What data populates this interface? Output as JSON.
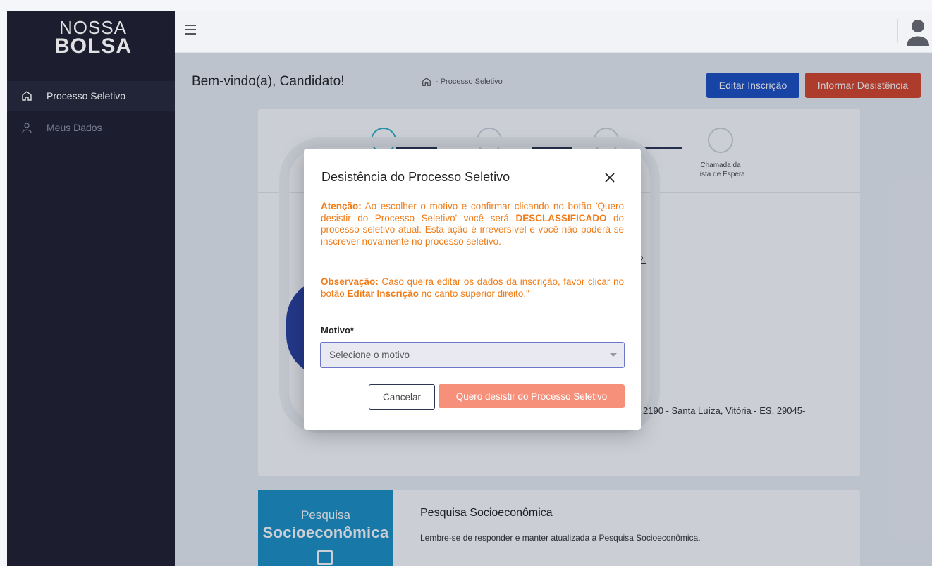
{
  "brand": {
    "line1": "NOSSA",
    "line2": "BOLSA"
  },
  "sidebar": {
    "items": [
      {
        "label": "Processo Seletivo",
        "icon": "home-icon",
        "active": true
      },
      {
        "label": "Meus Dados",
        "icon": "user-icon",
        "active": false
      }
    ]
  },
  "header": {
    "welcome": "Bem-vindo(a), Candidato!",
    "breadcrumb": "· Processo Seletivo",
    "edit_label": "Editar Inscrição",
    "quit_label": "Informar Desistência"
  },
  "steps": {
    "label_line1": "Chamada da",
    "label_line2": "Lista de Espera"
  },
  "address_partial": "2190 - Santa Luíza, Vitória - ES, 29045-",
  "small_link": "2.",
  "pesquisa": {
    "image_line1": "Pesquisa",
    "image_line2": "Socioeconômica",
    "title": "Pesquisa Socioeconômica",
    "text": "Lembre-se de responder e manter atualizada a Pesquisa Socioeconômica."
  },
  "modal": {
    "title": "Desistência do Processo Seletivo",
    "warning_label": "Atenção:",
    "warning_text_1": " Ao escolher o motivo e confirmar clicando no botão 'Quero desistir do Processo Seletivo' você será ",
    "warning_emphasis": "DESCLASSIFICADO",
    "warning_text_2": " do processo seletivo atual. Esta ação é irreversível e você não poderá se inscrever novamente no processo seletivo.",
    "obs_label": "Observação:",
    "obs_text_1": " Caso queira editar os dados da inscrição, favor clicar no botão ",
    "obs_emphasis": "Editar Inscrição",
    "obs_text_2": " no canto superior direito.\"",
    "motivo_label": "Motivo*",
    "select_placeholder": "Selecione o motivo",
    "cancel_label": "Cancelar",
    "confirm_label": "Quero desistir do Processo Seletivo"
  },
  "colors": {
    "sidebar_bg": "#1f2233",
    "primary_blue": "#1a4fc4",
    "danger_red": "#d9452a",
    "warning_orange": "#f07b17",
    "confirm_salmon": "#f7907b"
  }
}
